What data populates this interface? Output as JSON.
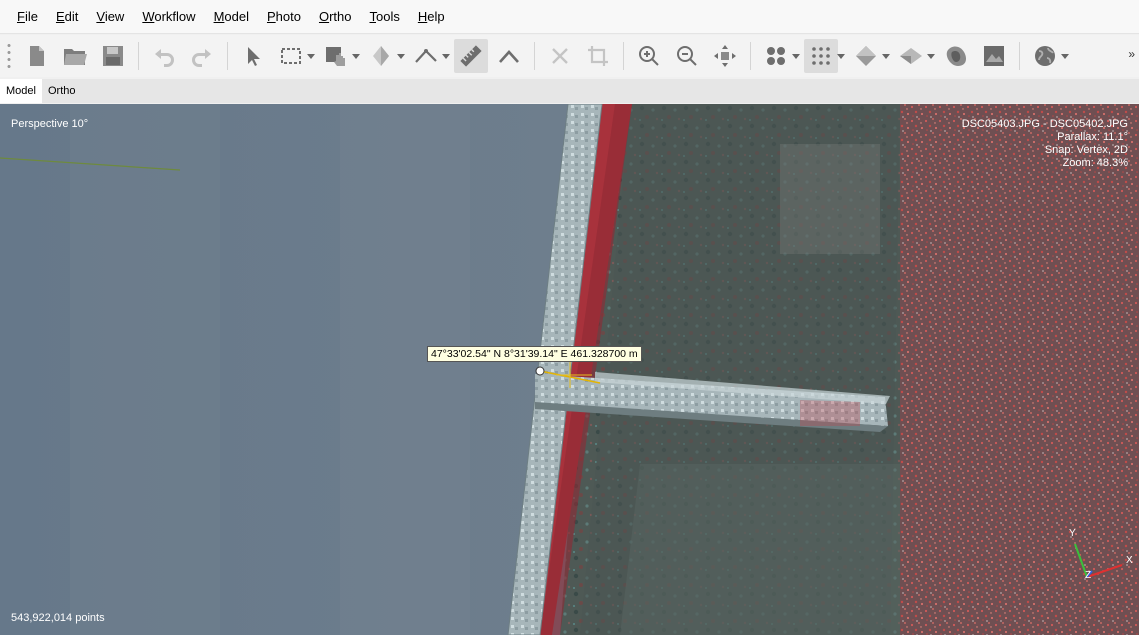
{
  "menu": [
    {
      "key": "file",
      "accel": "F",
      "rest": "ile"
    },
    {
      "key": "edit",
      "accel": "E",
      "rest": "dit"
    },
    {
      "key": "view",
      "accel": "V",
      "rest": "iew"
    },
    {
      "key": "workflow",
      "accel": "W",
      "rest": "orkflow"
    },
    {
      "key": "model",
      "accel": "M",
      "rest": "odel"
    },
    {
      "key": "photo",
      "accel": "P",
      "rest": "hoto"
    },
    {
      "key": "ortho",
      "accel": "O",
      "rest": "rtho"
    },
    {
      "key": "tools",
      "accel": "T",
      "rest": "ools"
    },
    {
      "key": "help",
      "accel": "H",
      "rest": "elp"
    }
  ],
  "toolbar": {
    "more": "»",
    "icons": [
      "new-document-icon",
      "open-folder-icon",
      "save-icon",
      "undo-icon",
      "redo-icon",
      "navigation-arrow-icon",
      "rectangle-selection-icon",
      "free-form-selection-icon",
      "draw-polygon-icon",
      "draw-polyline-icon",
      "ruler-icon",
      "draw-point-icon",
      "delete-icon",
      "crop-icon",
      "zoom-in-icon",
      "zoom-out-icon",
      "reset-view-icon",
      "show-cameras-icon",
      "point-cloud-icon",
      "shaded-model-icon",
      "textured-model-icon",
      "dem-icon",
      "orthomosaic-icon",
      "globe-icon"
    ],
    "active_tool": "ruler-icon"
  },
  "tabs": [
    {
      "label": "Model",
      "active": true
    },
    {
      "label": "Ortho",
      "active": false
    }
  ],
  "viewport": {
    "projection": "Perspective 10°",
    "photos": "DSC05403.JPG - DSC05402.JPG",
    "parallax": "Parallax: 11.1°",
    "snap": "Snap: Vertex, 2D",
    "zoom": "Zoom: 48.3%",
    "points": "543,922,014 points",
    "measurement": "47°33'02.54\" N  8°31'39.14\" E  461.328700 m",
    "axes": {
      "x": "X",
      "y": "Y",
      "z": "Z"
    }
  },
  "colors": {
    "sky": "#6c7c8b",
    "wall_red": "#a8323c",
    "pier": "#a9b6ba",
    "ground": "#4f5a55",
    "noise_red": "#c8504e",
    "tooltip_bg": "#ffffe1",
    "measure_line": "#e4b400"
  }
}
